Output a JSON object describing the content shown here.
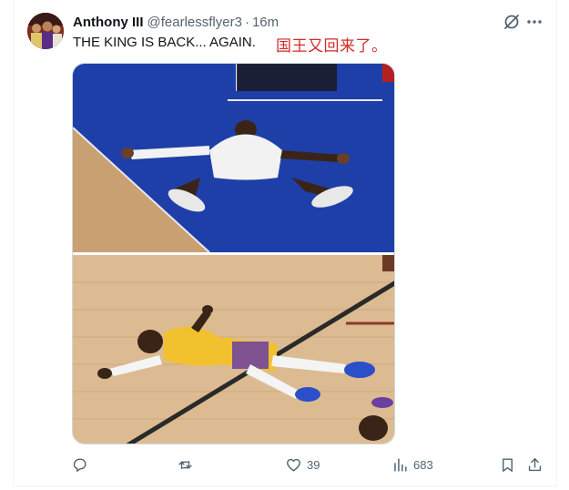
{
  "tweet": {
    "author_name": "Anthony III",
    "handle": "@fearlessflyer3",
    "separator": "·",
    "time": "16m",
    "text": "THE KING IS BACK... AGAIN.",
    "overlay_note": "国王又回来了。"
  },
  "media": {
    "panels": [
      {
        "description_icon": "photo",
        "court_color": "#1f3fa8"
      },
      {
        "description_icon": "photo",
        "court_color": "#d8b98f"
      }
    ]
  },
  "actions": {
    "reply_count": "",
    "retweet_count": "",
    "like_count": "39",
    "views_count": "683"
  },
  "colors": {
    "secondary_text": "#536471",
    "border": "#cfd9de",
    "overlay_red": "#d42a2a"
  },
  "icons": [
    "grok-icon",
    "more-icon",
    "reply-icon",
    "retweet-icon",
    "like-icon",
    "views-icon",
    "bookmark-icon",
    "share-icon"
  ]
}
